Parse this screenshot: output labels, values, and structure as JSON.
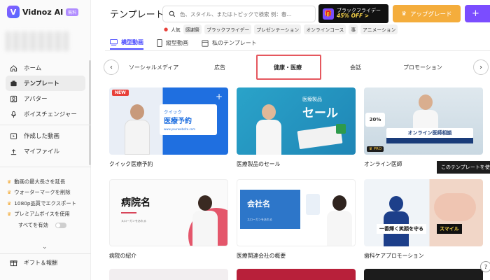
{
  "app": {
    "name": "Vidnoz AI",
    "badge": "無料"
  },
  "sidebar": {
    "items": [
      {
        "label": "ホーム",
        "icon": "home-icon"
      },
      {
        "label": "テンプレート",
        "icon": "template-icon"
      },
      {
        "label": "アバター",
        "icon": "avatar-icon"
      },
      {
        "label": "ボイスチェンジャー",
        "icon": "voice-changer-icon"
      }
    ],
    "items2": [
      {
        "label": "作成した動画",
        "icon": "video-icon"
      },
      {
        "label": "マイファイル",
        "icon": "upload-icon"
      }
    ],
    "features": [
      "動画の最大長さを延長",
      "ウォーターマークを削除",
      "1080p品質でエクスポート",
      "プレミアムボイスを使用"
    ],
    "toggle_label": "すべてを有効",
    "gift_label": "ギフト＆報酬"
  },
  "header": {
    "title": "テンプレート",
    "search_placeholder": "色、スタイル、またはトピックで検索 例：春...",
    "bf_line1": "ブラックフライデー",
    "bf_line2": "45% OFF >",
    "upgrade_label": "アップグレード",
    "plus_label": "+"
  },
  "popular": {
    "label": "人気",
    "tags": [
      "感謝祭",
      "ブラックフライデー",
      "プレゼンテーション",
      "オンラインコース",
      "事",
      "アニメーション"
    ]
  },
  "subtabs": [
    {
      "label": "横型動画",
      "active": true
    },
    {
      "label": "縦型動画",
      "active": false
    },
    {
      "label": "私のテンプレート",
      "active": false
    }
  ],
  "categories": [
    "ソーシャルメディア",
    "広告",
    "健康・医療",
    "会話",
    "プロモーション"
  ],
  "cards": [
    {
      "caption": "クイック医療予約",
      "badge": "NEW",
      "line1": "クイック",
      "line2": "医療予約",
      "url": "www.yourwebsite.com"
    },
    {
      "caption": "医療製品のセール",
      "line1": "医療製品",
      "line2": "セール"
    },
    {
      "caption": "オンライン医師",
      "percent": "20%",
      "headline": "オンライン医師相談",
      "pro": "PRO"
    },
    {
      "caption": "病院の紹介",
      "line1": "病院名",
      "line2": "スローガンをあれる"
    },
    {
      "caption": "医療関連会社の概要",
      "line1": "会社名",
      "line2": "スローガンをあれる"
    },
    {
      "caption": "歯科ケアプロモーション",
      "line1": "一番輝く笑顔を守る",
      "line2": "スマイル"
    }
  ],
  "tooltip": "このテンプレートを使用",
  "colors": {
    "accent": "#7b4dff",
    "upgrade": "#f4ad3c",
    "highlight": "#e5575e"
  }
}
